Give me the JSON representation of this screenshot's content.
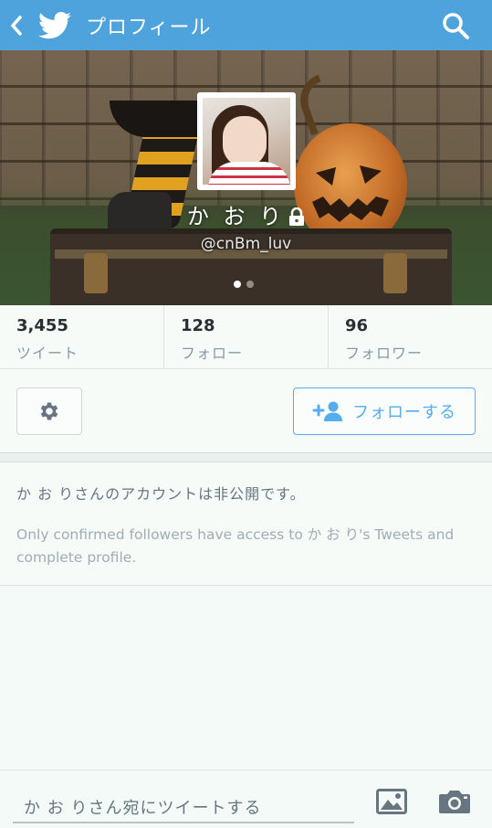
{
  "appbar": {
    "title": "プロフィール",
    "back_icon": "chevron-left-icon",
    "logo_icon": "twitter-bird-icon",
    "search_icon": "search-icon",
    "color": "#4fa3dd"
  },
  "profile": {
    "name": "か お り",
    "handle": "@cnBm_luv",
    "protected_icon": "lock-icon",
    "page_indicator": {
      "pages": 2,
      "active": 1
    }
  },
  "stats": [
    {
      "value": "3,455",
      "label": "ツイート"
    },
    {
      "value": "128",
      "label": "フォロー"
    },
    {
      "value": "96",
      "label": "フォロワー"
    }
  ],
  "actions": {
    "settings_icon": "gear-icon",
    "follow_icon": "add-user-icon",
    "follow_label": "フォローする",
    "accent": "#55acee"
  },
  "notice": {
    "title": "か お りさんのアカウントは非公開です。",
    "body": "Only confirmed followers have access to か お り's Tweets and complete profile."
  },
  "compose": {
    "placeholder": "か お りさん宛にツイートする",
    "photo_icon": "image-icon",
    "camera_icon": "camera-icon"
  }
}
